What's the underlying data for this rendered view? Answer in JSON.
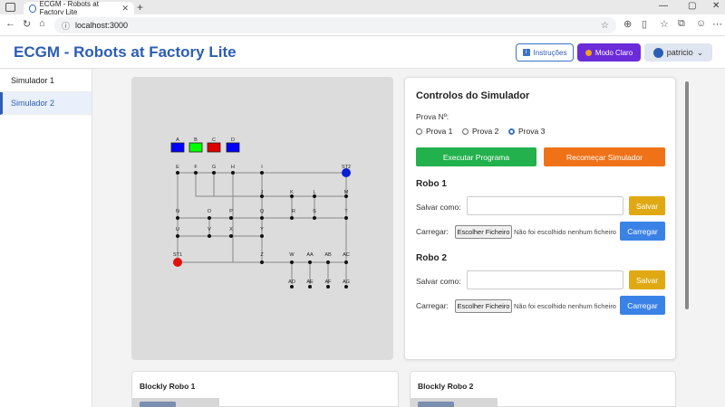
{
  "browser": {
    "tab_title": "ECGM - Robots at Factory Lite",
    "tab_close": "✕",
    "new_tab": "+",
    "url": "localhost:3000",
    "controls": {
      "minimize": "—",
      "maximize": "▢",
      "close": "✕"
    }
  },
  "app": {
    "title": "ECGM - Robots at Factory Lite"
  },
  "header": {
    "instructions_label": "Instruções",
    "theme_label": "Modo Claro",
    "user_label": "patricio",
    "user_chevron": "⌄"
  },
  "sidebar": {
    "items": [
      {
        "label": "Simulador 1"
      },
      {
        "label": "Simulador 2"
      }
    ]
  },
  "map": {
    "colors": {
      "A": "#0000ff",
      "B": "#00ff00",
      "C": "#dd0000",
      "D": "#0000ff"
    },
    "nodes": [
      "A",
      "B",
      "C",
      "D",
      "E",
      "F",
      "G",
      "H",
      "I",
      "ST2",
      "J",
      "K",
      "L",
      "M",
      "N",
      "O",
      "P",
      "Q",
      "R",
      "S",
      "T",
      "U",
      "V",
      "X",
      "Y",
      "ST1",
      "Z",
      "W",
      "AA",
      "AB",
      "AC",
      "AD",
      "AE",
      "AF",
      "AG"
    ]
  },
  "controls": {
    "title": "Controlos do Simulador",
    "prova_label": "Prova Nº:",
    "options": [
      "Prova 1",
      "Prova 2",
      "Prova 3"
    ],
    "selected": "Prova 3",
    "run_label": "Executar Programa",
    "restart_label": "Recomeçar Simulador",
    "robots": [
      {
        "title": "Robo 1",
        "save_as_label": "Salvar como:",
        "save_button": "Salvar",
        "load_label": "Carregar:",
        "file_button": "Escolher Ficheiro",
        "no_file": "Não foi escolhido nenhum ficheiro",
        "load_button": "Carregar"
      },
      {
        "title": "Robo 2",
        "save_as_label": "Salvar como:",
        "save_button": "Salvar",
        "load_label": "Carregar:",
        "file_button": "Escolher Ficheiro",
        "no_file": "Não foi escolhido nenhum ficheiro",
        "load_button": "Carregar"
      }
    ]
  },
  "blockly": [
    {
      "title": "Blockly Robo 1"
    },
    {
      "title": "Blockly Robo 2"
    }
  ],
  "colors": {
    "accent": "#2c5db3",
    "run": "#22b14c",
    "restart": "#f07218",
    "save": "#e0a914",
    "load": "#3b82e6",
    "theme": "#6c2bd9"
  }
}
